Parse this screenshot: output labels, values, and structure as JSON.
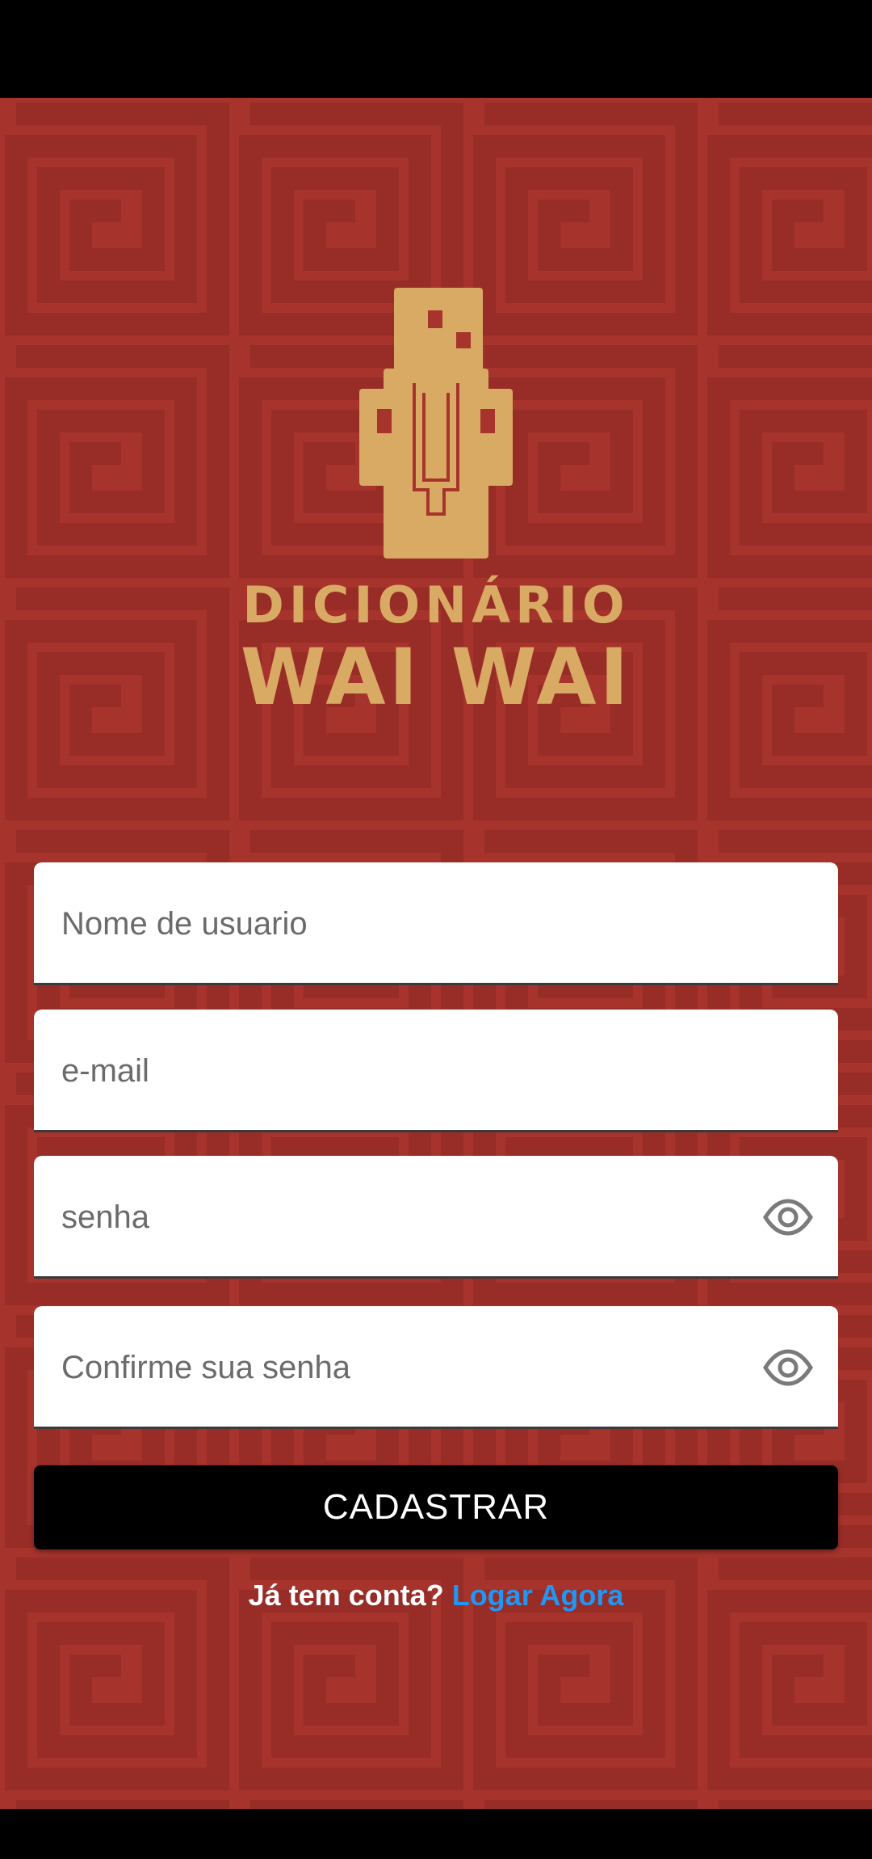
{
  "logo": {
    "line1": "DICIONÁRIO",
    "line2": "WAI WAI"
  },
  "form": {
    "username": {
      "placeholder": "Nome de usuario",
      "value": ""
    },
    "email": {
      "placeholder": "e-mail",
      "value": ""
    },
    "password": {
      "placeholder": "senha",
      "value": "",
      "icon": "eye-icon"
    },
    "confirm_password": {
      "placeholder": "Confirme sua senha",
      "value": "",
      "icon": "eye-icon"
    },
    "submit_label": "CADASTRAR"
  },
  "login": {
    "prompt": "Já tem conta?",
    "link_label": "Logar Agora"
  },
  "colors": {
    "background": "#a6332c",
    "pattern": "#952b25",
    "logo": "#d9aa63",
    "link": "#2196f3",
    "button": "#000000"
  }
}
